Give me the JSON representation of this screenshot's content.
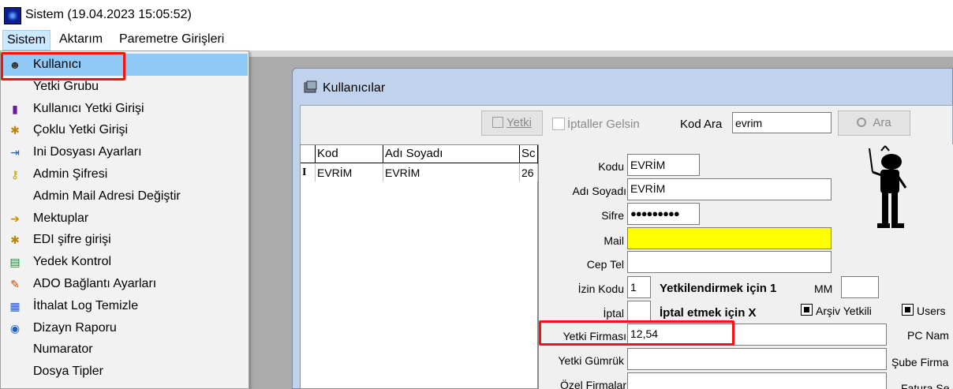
{
  "window": {
    "title": "Sistem (19.04.2023 15:05:52)"
  },
  "menubar": {
    "items": [
      "Sistem",
      "Aktarım",
      "Paremetre Girişleri"
    ]
  },
  "dropdown": {
    "items": [
      {
        "label": "Kullanıcı",
        "icon": "user-icon"
      },
      {
        "label": "Yetki Grubu",
        "icon": ""
      },
      {
        "label": "Kullanıcı Yetki Girişi",
        "icon": "tool-icon"
      },
      {
        "label": "Çoklu Yetki Girişi",
        "icon": "keys-icon"
      },
      {
        "label": "Ini Dosyası  Ayarları",
        "icon": "config-icon"
      },
      {
        "label": "Admin Şifresi",
        "icon": "key-icon"
      },
      {
        "label": "Admin Mail Adresi Değiştir",
        "icon": ""
      },
      {
        "label": "Mektuplar",
        "icon": "letter-icon"
      },
      {
        "label": "EDI şifre girişi",
        "icon": "keys-icon"
      },
      {
        "label": "Yedek Kontrol",
        "icon": "backup-icon"
      },
      {
        "label": "ADO Bağlantı Ayarları",
        "icon": "connection-icon"
      },
      {
        "label": "İthalat Log Temizle",
        "icon": "log-icon"
      },
      {
        "label": "Dizayn Raporu",
        "icon": "report-icon"
      },
      {
        "label": "Numarator",
        "icon": ""
      },
      {
        "label": "Dosya Tipler",
        "icon": ""
      }
    ]
  },
  "child_window": {
    "title": "Kullanıcılar",
    "toolbar": {
      "yetki_button": "Yetki",
      "iptaller_label": "İptaller Gelsin",
      "kod_ara_label": "Kod Ara",
      "search_value": "evrim",
      "ara_button": "Ara"
    },
    "grid": {
      "columns": [
        "Kod",
        "Adı Soyadı",
        "Sc"
      ],
      "rows": [
        [
          "EVRİM",
          "EVRİM",
          "26"
        ]
      ],
      "row_marker": "I"
    },
    "form": {
      "kodu_label": "Kodu",
      "kodu_value": "EVRİM",
      "adi_label": "Adı Soyadı",
      "adi_value": "EVRİM",
      "sifre_label": "Sifre",
      "sifre_value": "●●●●●●●●●",
      "mail_label": "Mail",
      "mail_value": "",
      "cep_label": "Cep Tel",
      "cep_value": "",
      "izin_label": "İzin Kodu",
      "izin_value": "1",
      "izin_note": "Yetkilendirmek için 1",
      "mm_label": "MM",
      "mm_value": "",
      "iptal_label": "İptal",
      "iptal_value": "",
      "iptal_note": "İptal etmek için X",
      "arsiv_label": "Arşiv Yetkili",
      "users_label": "Users",
      "yetki_firmasi_label": "Yetki Firması",
      "yetki_firmasi_value": "12,54",
      "pc_label": "PC Nam",
      "yetki_gumruk_label": "Yetki Gümrük",
      "yetki_gumruk_value": "",
      "sube_label": "Şube Firma",
      "ozel_label": "Özel Firmalar",
      "fatura_label": "Fatura Se"
    },
    "colors": {
      "mail_bg": "#ffff00",
      "highlight_border": "#ff1010"
    }
  }
}
